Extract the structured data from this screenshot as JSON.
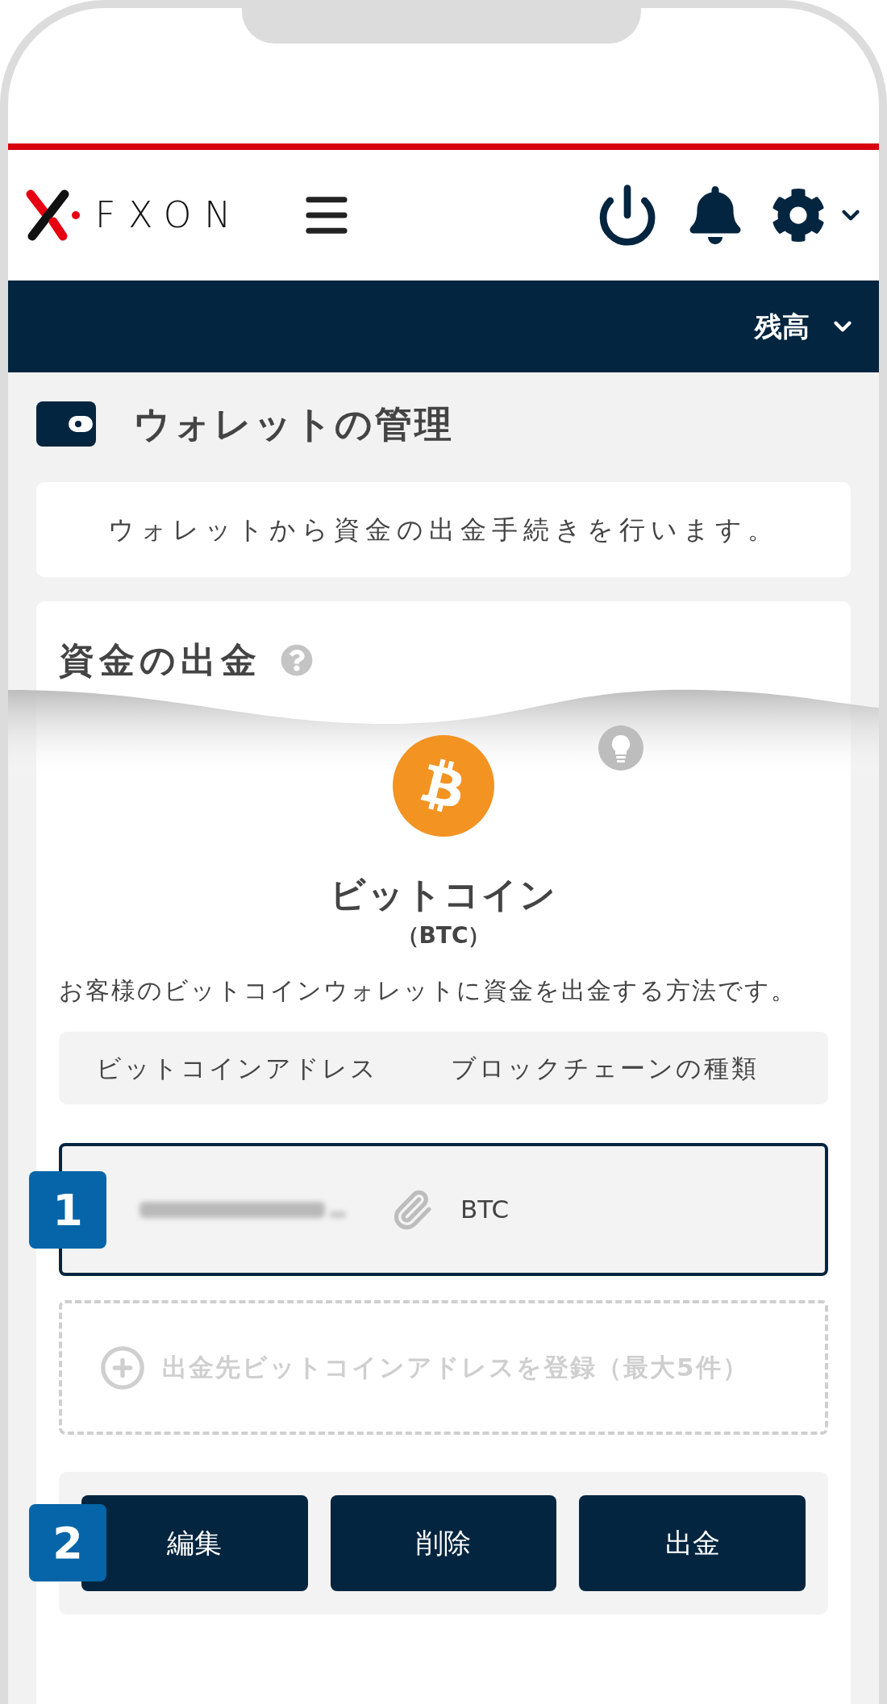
{
  "header": {
    "logo": "FXON"
  },
  "balance_bar": {
    "label": "残高"
  },
  "page_title": "ウォレットの管理",
  "intro": "ウォレットから資金の出金手続きを行います。",
  "section": {
    "title": "資金の出金",
    "coin_name": "ビットコイン",
    "ticker": "（BTC）",
    "description": "お客様のビットコインウォレットに資金を出金する方法です。",
    "columns": [
      "ビットコインアドレス",
      "ブロックチェーンの種類"
    ],
    "addresses": [
      {
        "chain": "BTC",
        "selected": true,
        "step": "1"
      }
    ],
    "add_label": "出金先ビットコインアドレスを登録（最大5件）",
    "actions_step": "2",
    "buttons": [
      "編集",
      "削除",
      "出金"
    ]
  }
}
